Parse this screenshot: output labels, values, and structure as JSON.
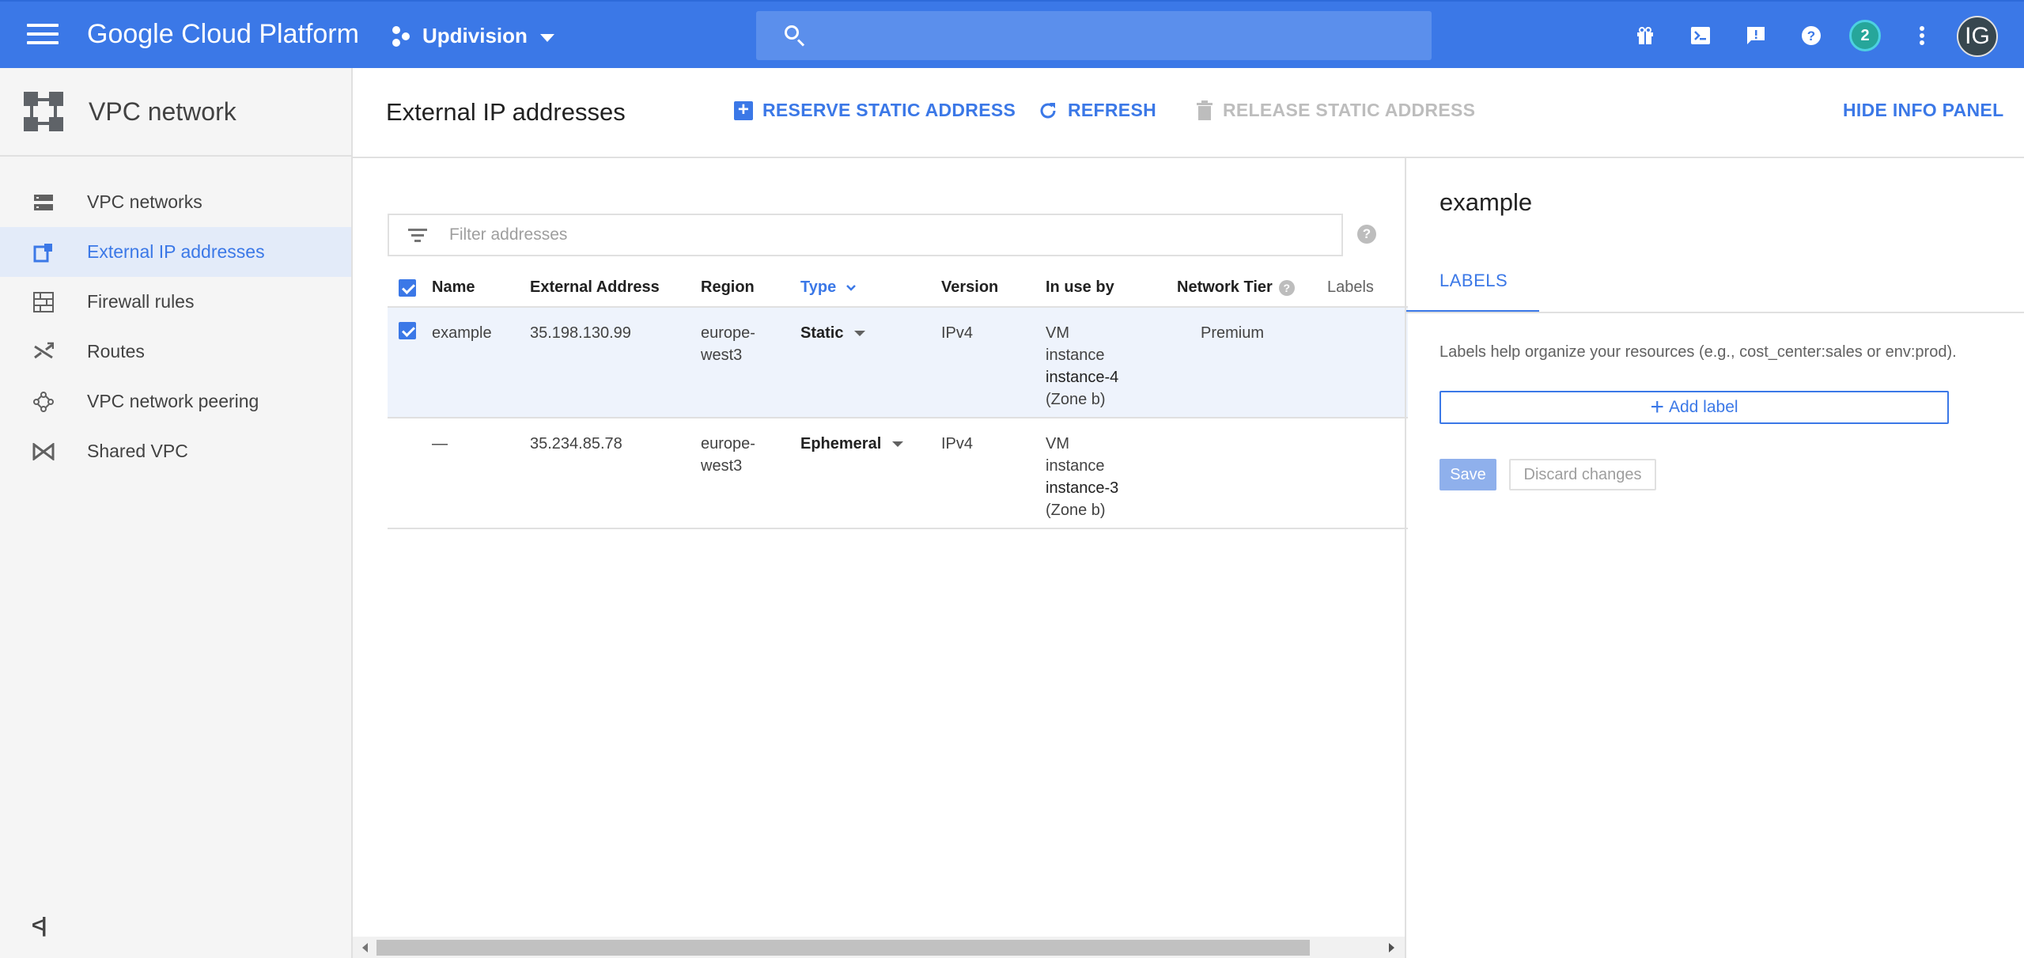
{
  "topbar": {
    "brand": "Google Cloud Platform",
    "project": "Updivision",
    "search_placeholder": "",
    "notification_count": "2",
    "avatar_initials": "IG",
    "icons": [
      "gift-icon",
      "cloud-shell-icon",
      "feedback-icon",
      "help-icon",
      "notifications-icon",
      "more-vert-icon"
    ]
  },
  "sidebar": {
    "title": "VPC network",
    "items": [
      {
        "label": "VPC networks",
        "icon": "vpc-networks-icon"
      },
      {
        "label": "External IP addresses",
        "icon": "external-ip-icon",
        "active": true
      },
      {
        "label": "Firewall rules",
        "icon": "firewall-icon"
      },
      {
        "label": "Routes",
        "icon": "routes-icon"
      },
      {
        "label": "VPC network peering",
        "icon": "peering-icon"
      },
      {
        "label": "Shared VPC",
        "icon": "shared-vpc-icon"
      }
    ],
    "collapse_label": "<|"
  },
  "header": {
    "title": "External IP addresses",
    "reserve_label": "RESERVE STATIC ADDRESS",
    "refresh_label": "REFRESH",
    "release_label": "RELEASE STATIC ADDRESS",
    "hide_panel_label": "HIDE INFO PANEL"
  },
  "filter": {
    "placeholder": "Filter addresses"
  },
  "table": {
    "columns": [
      "Name",
      "External Address",
      "Region",
      "Type",
      "Version",
      "In use by",
      "Network Tier",
      "Labels"
    ],
    "rows": [
      {
        "selected": true,
        "name": "example",
        "address": "35.198.130.99",
        "region_1": "europe-",
        "region_2": "west3",
        "type": "Static",
        "version": "IPv4",
        "inuse_1": "VM",
        "inuse_2": "instance",
        "inuse_3": "instance-4",
        "inuse_4": "(Zone b)",
        "tier": "Premium"
      },
      {
        "selected": false,
        "name": "—",
        "address": "35.234.85.78",
        "region_1": "europe-",
        "region_2": "west3",
        "type": "Ephemeral",
        "version": "IPv4",
        "inuse_1": "VM",
        "inuse_2": "instance",
        "inuse_3": "instance-3",
        "inuse_4": "(Zone b)",
        "tier": ""
      }
    ]
  },
  "info_panel": {
    "title": "example",
    "tab": "LABELS",
    "description": "Labels help organize your resources (e.g., cost_center:sales or env:prod).",
    "add_label": "Add label",
    "save": "Save",
    "discard": "Discard changes"
  },
  "colors": {
    "topbar": "#3b78e7",
    "accent": "#3b78e7"
  }
}
